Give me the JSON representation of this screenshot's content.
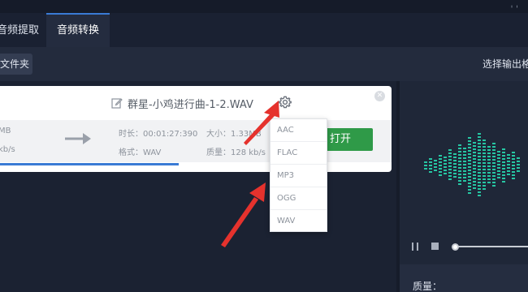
{
  "tabs": [
    {
      "label": "音频提取"
    },
    {
      "label": "音频转换"
    }
  ],
  "toolbar": {
    "folder_button": "文件夹",
    "output_label": "选择输出格"
  },
  "file": {
    "name": "群星-小鸡进行曲-1-2.WAV",
    "size_left": "MB",
    "bitrate_left": "kb/s",
    "duration": "时长：00:01:27:390",
    "size": "大小：1.33MB",
    "format": "格式：WAV",
    "quality": "质量：128 kb/s",
    "open_button": "打开",
    "progress": 0.67
  },
  "format_menu": {
    "options": [
      "AAC",
      "FLAC",
      "MP3",
      "OGG",
      "WAV"
    ]
  },
  "right_panel": {
    "quality_label": "质量："
  },
  "colors": {
    "accent_blue": "#3a7bd5",
    "open_green": "#2f9a48",
    "eq_teal": "#26c6a3",
    "annotation_red": "#e5322d"
  },
  "icons": {
    "edit": "edit-icon",
    "settings": "gear-icon",
    "close": "close-icon",
    "convert_arrow": "arrow-right-icon",
    "pause": "pause-icon",
    "stop": "stop-icon"
  }
}
